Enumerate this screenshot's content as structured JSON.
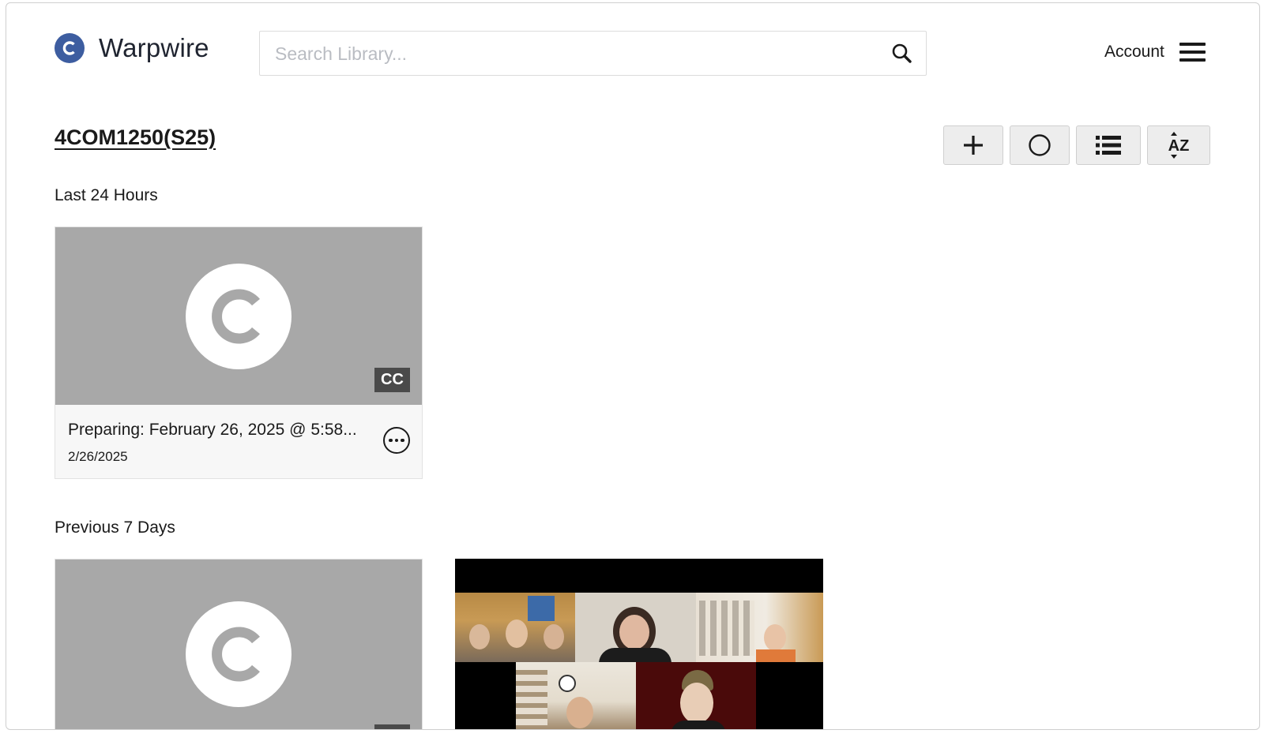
{
  "header": {
    "brand": "Warpwire",
    "search_placeholder": "Search Library...",
    "account_label": "Account"
  },
  "page": {
    "title": "4COM1250(S25)"
  },
  "toolbar": {
    "buttons": [
      {
        "name": "add-media-button",
        "icon": "plus-icon"
      },
      {
        "name": "record-button",
        "icon": "circle-icon"
      },
      {
        "name": "list-view-button",
        "icon": "list-icon"
      },
      {
        "name": "sort-button",
        "icon": "sort-az-icon",
        "text": "AZ"
      }
    ]
  },
  "sections": [
    {
      "label": "Last 24 Hours",
      "items": [
        {
          "title": "Preparing: February 26, 2025 @ 5:58...",
          "date": "2/26/2025",
          "badge": "CC"
        }
      ]
    },
    {
      "label": "Previous 7 Days",
      "items": [
        {
          "title": "",
          "date": "",
          "badge": "",
          "thumbnail": "placeholder-logo"
        },
        {
          "title": "",
          "date": "",
          "thumbnail": "video-call-grid"
        }
      ]
    }
  ],
  "colors": {
    "brand_blue": "#3d5da0",
    "thumb_gray": "#a8a8a8",
    "cc_badge": "#4a4a4a",
    "toolbar_bg": "#ededed"
  }
}
